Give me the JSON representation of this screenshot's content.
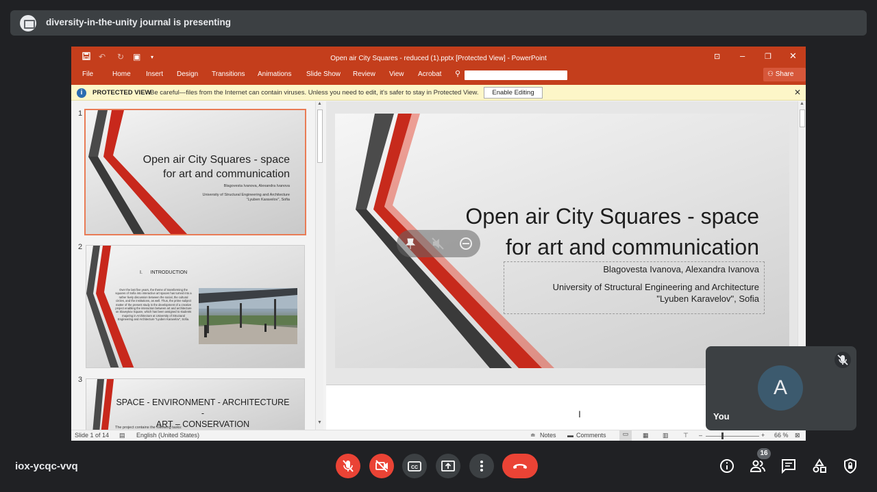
{
  "meet": {
    "banner_text": "diversity-in-the-unity journal is presenting",
    "meeting_code": "iox-ycqc-vvq",
    "self_label": "You",
    "self_initial": "A",
    "participants_count": "16"
  },
  "powerpoint": {
    "window_title": "Open air City Squares - reduced (1).pptx [Protected View] - PowerPoint",
    "ribbon_tabs": [
      "File",
      "Home",
      "Insert",
      "Design",
      "Transitions",
      "Animations",
      "Slide Show",
      "Review",
      "View",
      "Acrobat"
    ],
    "share_label": "Share",
    "protected_view": {
      "label": "PROTECTED VIEW",
      "message": "Be careful—files from the Internet can contain viruses. Unless you need to edit, it's safer to stay in Protected View.",
      "button": "Enable Editing"
    },
    "thumbnails": [
      {
        "number": "1",
        "title_line1": "Open air City Squares - space",
        "title_line2": "for art and communication",
        "authors": "Blagovesta Ivanova, Alexandra Ivanova",
        "affil_line1": "University of Structural Engineering and Architecture",
        "affil_line2": "\"Lyuben Karavelov\", Sofia"
      },
      {
        "number": "2",
        "heading": "I.      INTRODUCTION",
        "body": "Over the last five years, the theme of transforming the squares of Sofia into interactive art spaces has turned into a rather lively discussion between the social, the cultural circles, and the institutions, as well. Thus, the prime subject matter of the present study is the development of a creative project enabling the interaction between art and architecture on Slaveykov Square, which has been assigned to students majoring in Architecture at University of Structural Engineering and Architecture \"Lyuben Karavelov\", Sofia."
      },
      {
        "number": "3",
        "heading_line1": "SPACE - ENVIRONMENT - ARCHITECTURE -",
        "heading_line2": "ART – CONSERVATION",
        "body": "The project contains the following tasks:"
      }
    ],
    "main_slide": {
      "title_line1": "Open air City Squares - space",
      "title_line2": "for art and communication",
      "authors": "Blagovesta Ivanova, Alexandra Ivanova",
      "affil_line1": "University of Structural Engineering and Architecture",
      "affil_line2": "\"Lyuben Karavelov\", Sofia"
    },
    "status": {
      "slide": "Slide 1 of 14",
      "language": "English (United States)",
      "notes": "Notes",
      "comments": "Comments",
      "zoom": "66 %"
    }
  },
  "colors": {
    "ppt_accent": "#c43e1c",
    "meet_red": "#ea4335",
    "meet_bg": "#202124"
  }
}
